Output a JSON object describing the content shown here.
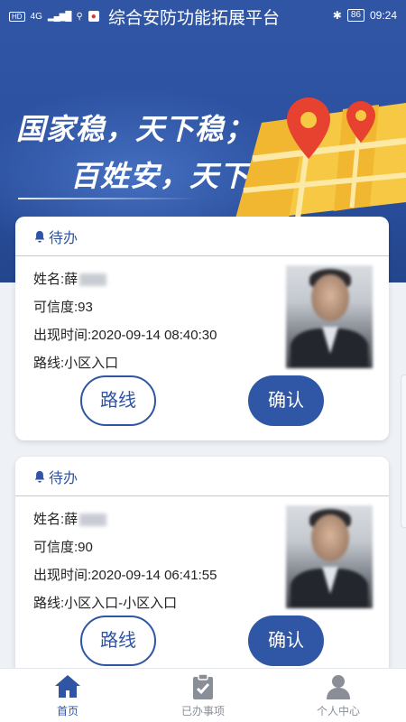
{
  "status_bar": {
    "network": "HD",
    "signal": "4G",
    "title": "综合安防功能拓展平台",
    "battery": "86",
    "time": "09:24"
  },
  "hero": {
    "slogan_line1": "国家稳，天下稳；",
    "slogan_line2": "百姓安，天下安。"
  },
  "cards": [
    {
      "header": "待办",
      "name_label": "姓名:",
      "name_value": "薛",
      "credibility_label": "可信度:",
      "credibility_value": "93",
      "time_label": "出现时间:",
      "time_value": "2020-09-14 08:40:30",
      "route_label": "路线:",
      "route_value": "小区入口",
      "route_button": "路线",
      "confirm_button": "确认"
    },
    {
      "header": "待办",
      "name_label": "姓名:",
      "name_value": "薛",
      "credibility_label": "可信度:",
      "credibility_value": "90",
      "time_label": "出现时间:",
      "time_value": "2020-09-14 06:41:55",
      "route_label": "路线:",
      "route_value": "小区入口-小区入口",
      "route_button": "路线",
      "confirm_button": "确认"
    }
  ],
  "bottom_nav": {
    "items": [
      {
        "label": "首页",
        "icon": "home-icon",
        "active": true
      },
      {
        "label": "已办事项",
        "icon": "clipboard-check-icon",
        "active": false
      },
      {
        "label": "个人中心",
        "icon": "user-icon",
        "active": false
      }
    ]
  },
  "colors": {
    "primary": "#2f55a4",
    "background": "#eef1f6",
    "inactive": "#8a8f97"
  }
}
